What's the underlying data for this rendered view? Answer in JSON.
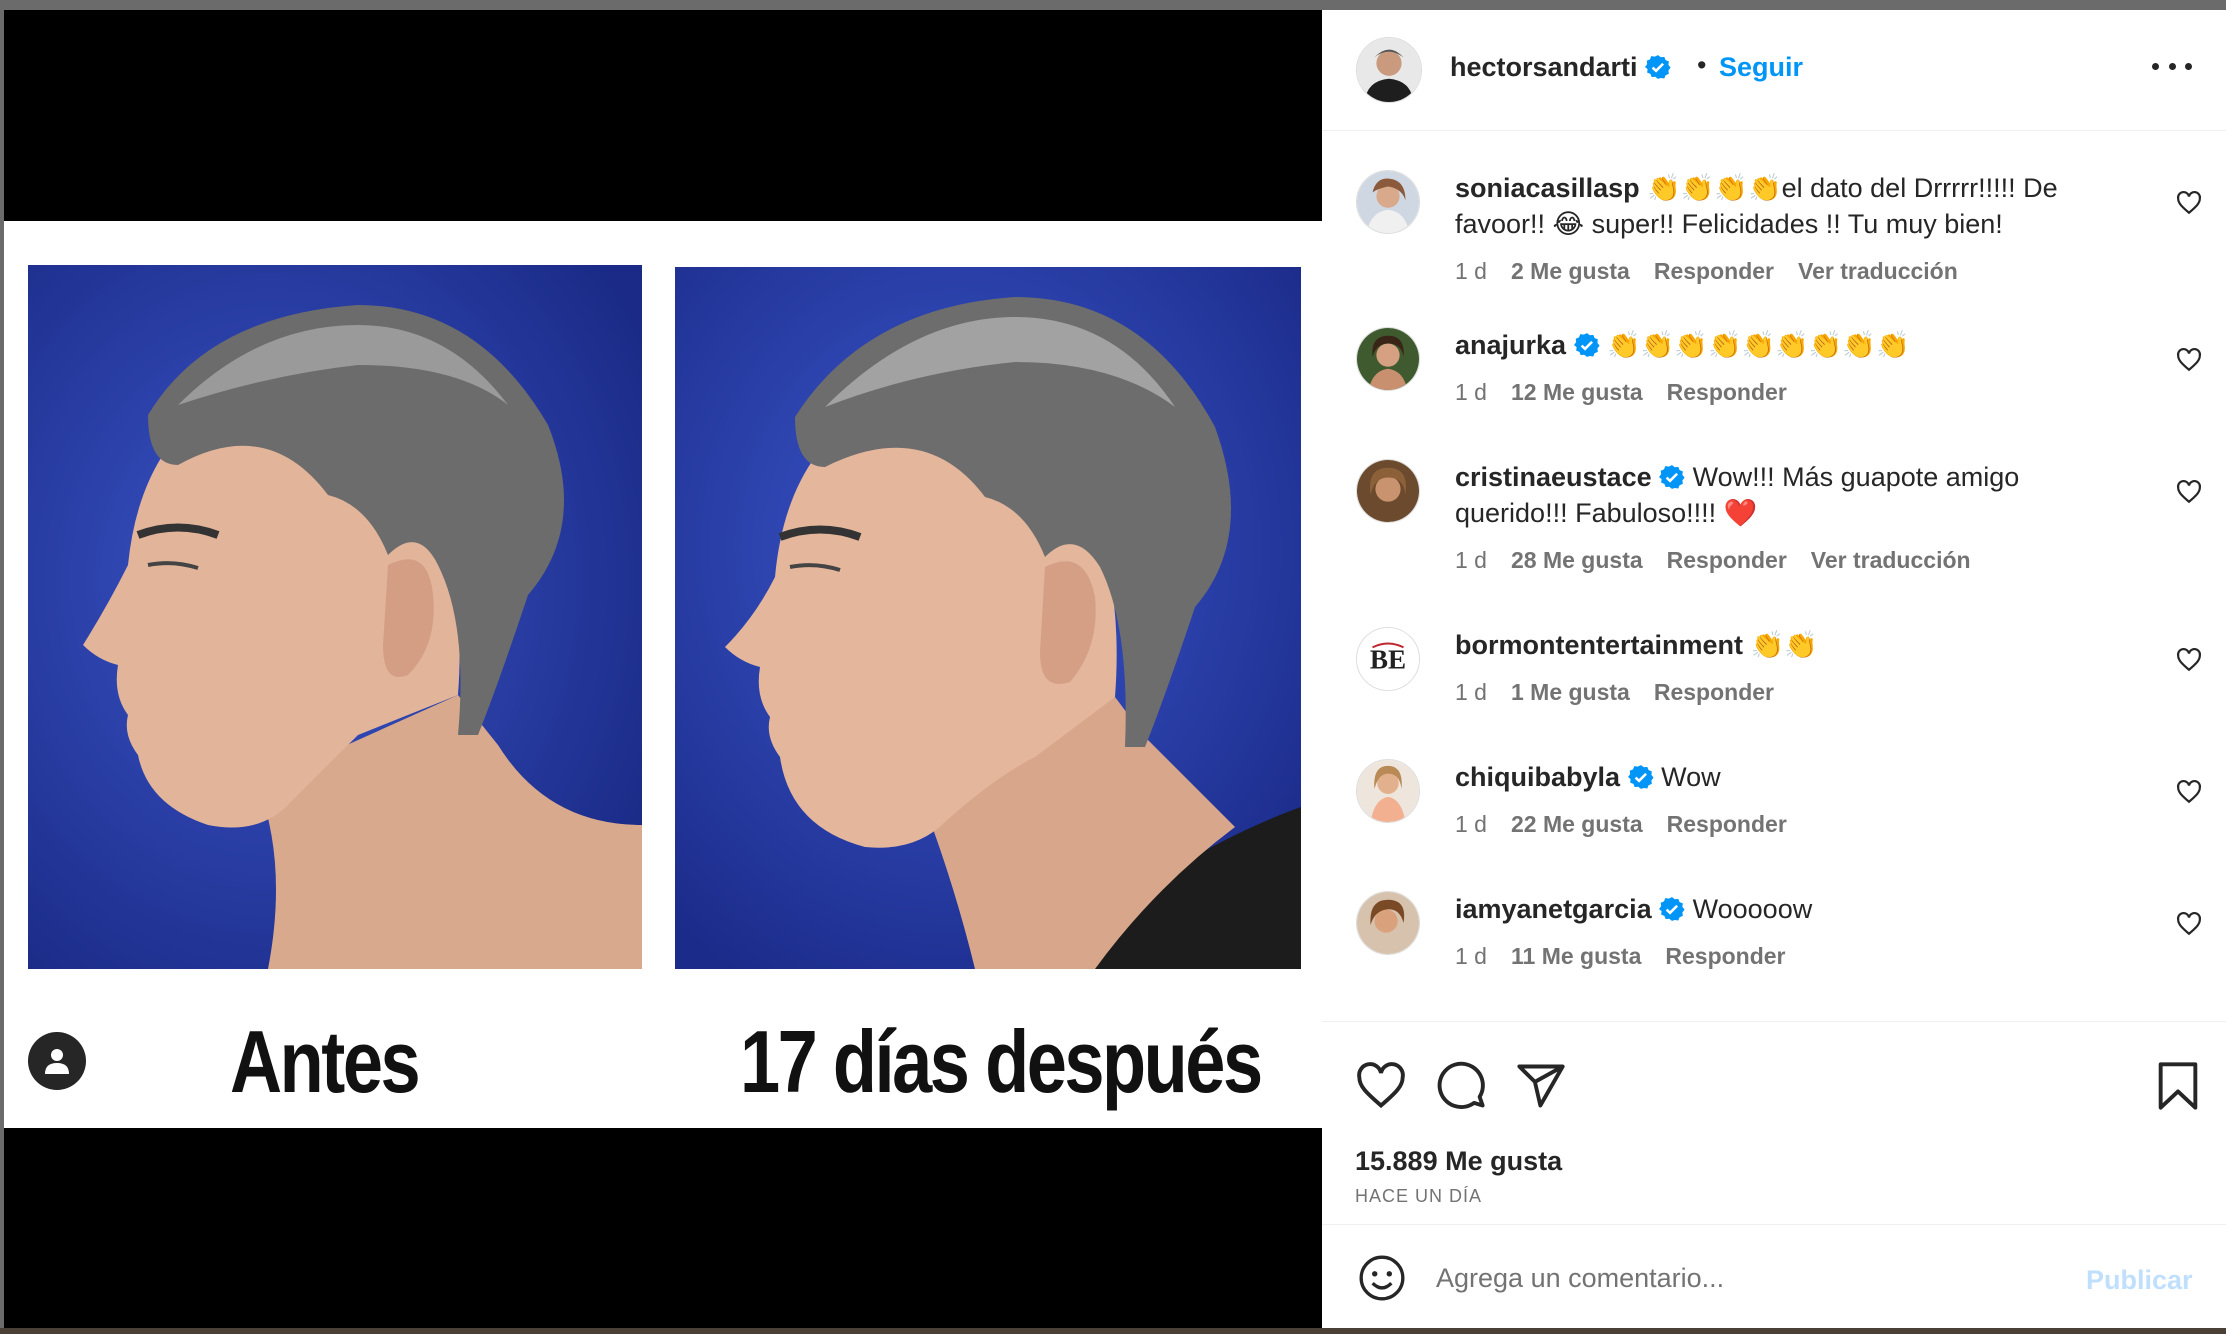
{
  "post": {
    "username": "hectorsandarti",
    "separator": "•",
    "follow_label": "Seguir",
    "captions": {
      "before": "Antes",
      "after": "17 días después"
    },
    "likes": "15.889 Me gusta",
    "time_ago": "HACE UN DÍA"
  },
  "comments": [
    {
      "user": "soniacasillasp",
      "verified": false,
      "text": "👏👏👏👏el dato del Drrrrr!!!!! De favoor!! 😂 super!! Felicidades !! Tu muy bien!",
      "time": "1 d",
      "likes": "2 Me gusta",
      "reply": "Responder",
      "translate": "Ver traducción"
    },
    {
      "user": "anajurka",
      "verified": true,
      "text": "👏👏👏👏👏👏👏👏👏",
      "time": "1 d",
      "likes": "12 Me gusta",
      "reply": "Responder",
      "translate": ""
    },
    {
      "user": "cristinaeustace",
      "verified": true,
      "text": "Wow!!! Más guapote amigo querido!!! Fabuloso!!!! ❤️",
      "time": "1 d",
      "likes": "28 Me gusta",
      "reply": "Responder",
      "translate": "Ver traducción"
    },
    {
      "user": "bormontentertainment",
      "verified": false,
      "text": "👏👏",
      "time": "1 d",
      "likes": "1 Me gusta",
      "reply": "Responder",
      "translate": ""
    },
    {
      "user": "chiquibabyla",
      "verified": true,
      "text": "Wow",
      "time": "1 d",
      "likes": "22 Me gusta",
      "reply": "Responder",
      "translate": ""
    },
    {
      "user": "iamyanetgarcia",
      "verified": true,
      "text": "Wooooow",
      "time": "1 d",
      "likes": "11 Me gusta",
      "reply": "Responder",
      "translate": ""
    }
  ],
  "bormont_logo_text": "BE",
  "composer": {
    "placeholder": "Agrega un comentario...",
    "publish_label": "Publicar"
  },
  "colors": {
    "link_blue": "#0095f6",
    "verified_blue": "#0095f6",
    "publish_disabled": "#c0dffd",
    "photo_background": "#2a3fa8"
  },
  "icons": [
    "user-tag-icon",
    "more-options-icon",
    "heart-icon",
    "comment-icon",
    "share-icon",
    "bookmark-icon",
    "emoji-icon",
    "verified-icon"
  ]
}
